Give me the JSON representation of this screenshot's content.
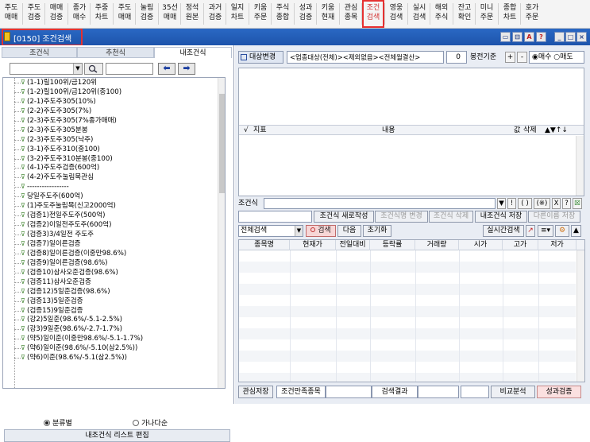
{
  "toolbar": {
    "items": [
      {
        "l1": "주도",
        "l2": "매매"
      },
      {
        "l1": "주도",
        "l2": "검증"
      },
      {
        "l1": "매매",
        "l2": "검증"
      },
      {
        "l1": "종가",
        "l2": "매수"
      },
      {
        "l1": "주중",
        "l2": "차트"
      },
      {
        "l1": "주도",
        "l2": "매매"
      },
      {
        "l1": "눌림",
        "l2": "검증"
      },
      {
        "l1": "35선",
        "l2": "매매"
      },
      {
        "l1": "정석",
        "l2": "원본"
      },
      {
        "l1": "과거",
        "l2": "검증"
      },
      {
        "l1": "일지",
        "l2": "차트"
      },
      {
        "l1": "키움",
        "l2": "주문"
      },
      {
        "l1": "주식",
        "l2": "종합"
      },
      {
        "l1": "성과",
        "l2": "검증"
      },
      {
        "l1": "키움",
        "l2": "현재"
      },
      {
        "l1": "관심",
        "l2": "종목"
      },
      {
        "l1": "조건",
        "l2": "검색"
      },
      {
        "l1": "영웅",
        "l2": "검색"
      },
      {
        "l1": "실시",
        "l2": "검색"
      },
      {
        "l1": "해외",
        "l2": "주식"
      },
      {
        "l1": "잔고",
        "l2": "확인"
      },
      {
        "l1": "미니",
        "l2": "주문"
      },
      {
        "l1": "종합",
        "l2": "차트"
      },
      {
        "l1": "호가",
        "l2": "주문"
      }
    ]
  },
  "window": {
    "title": "[0150] 조건검색",
    "buttons": [
      "▭",
      "⊟",
      "A",
      "?",
      "_",
      "□",
      "×"
    ]
  },
  "left": {
    "tabs": [
      "조건식",
      "추천식",
      "내조건식"
    ],
    "tree": [
      "(1-1)릴100위/금120위",
      "(1-2)릴100위/금120위(중100)",
      "(2-1)주도주305(10%)",
      "(2-2)주도주305(7%)",
      "(2-3)주도주305(7%종가매매)",
      "(2-3)주도주305분봉",
      "(2-3)주도주305(낙주)",
      "(3-1)주도주310(중100)",
      "(3-2)주도주310분봉(중100)",
      "(4-1)주도주검증(600억)",
      "(4-2)주도주눌림목관심",
      "-----------------",
      "당일주도주(600억)",
      "(1)주도주눌림목(신고2000억)",
      "(검증1)전일주도주(500억)",
      "(검증2)이일전주도주(600억)",
      "(검증3)3/4일전 주도주",
      "(검증7)일이른검증",
      "(검증8)일이른검증(이중만98.6%)",
      "(검증9)일이른검증(98.6%)",
      "(검증10)삼사오준검증(98.6%)",
      "(검증11)삼사오준검증",
      "(검증12)5일준검증(98.6%)",
      "(검증13)5일준검증",
      "(검증15)9일준검증",
      "(강2)5일준(98.6%/-5.1-2.5%)",
      "(강3)9일준(98.6%/-2.7-1.7%)",
      "(약5)일이준(이중만98.6%/-5.1-1.7%)",
      "(약6)일이준(98.6%/-5.10(삼2.5%))",
      "(약6)이준(98.6%/-5.1(삼2.5%))"
    ],
    "radio_1": "분류별",
    "radio_2": "가나다순",
    "list_edit": "내조건식 리스트 편집"
  },
  "right": {
    "target_btn": "대상변경",
    "target_text": "<업종대상(전체)><제외없음><전체월결산>",
    "spin_value": "0",
    "base_label": "봉전기준",
    "plus": "+",
    "minus": "-",
    "buy_label": "매수",
    "sell_label": "매도",
    "cond_headers": [
      "√",
      "지표",
      "내용",
      "값",
      "삭제",
      "▲▼↑↓"
    ],
    "cond_label": "조건식",
    "cond_opts": [
      "▼",
      "!",
      "( )",
      "(※)",
      "X",
      "?",
      "☒"
    ],
    "actions": [
      "조건식 새로작성",
      "조건식명 변경",
      "조건식 삭제",
      "내조건식 저장",
      "다른이름 저장"
    ],
    "search_scope": "전체검색",
    "search_btn": "검색",
    "next_btn": "다음",
    "reset_btn": "초기화",
    "realtime_btn": "실시간검색",
    "result_headers": [
      "종목명",
      "현재가",
      "전일대비",
      "등락률",
      "거래량",
      "시가",
      "고가",
      "저가"
    ],
    "bottom": {
      "save_interest": "관심저장",
      "satisfied_label": "조건만족종목",
      "result_label": "검색결과",
      "compare_btn": "비교분석",
      "verify_btn": "성과검증"
    }
  }
}
